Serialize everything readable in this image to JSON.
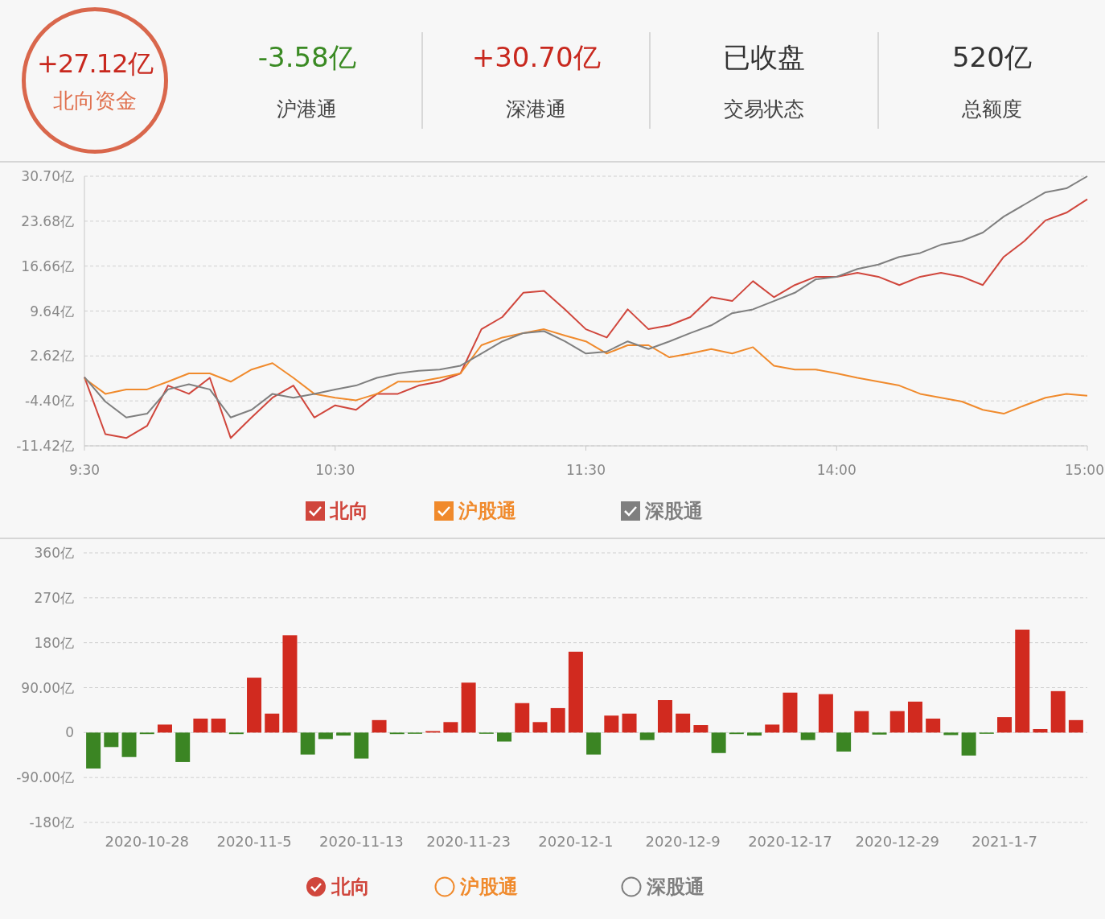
{
  "summary": {
    "value": "+27.12亿",
    "label": "北向资金",
    "kind": "up"
  },
  "stats": [
    {
      "value": "-3.58亿",
      "label": "沪港通",
      "kind": "down"
    },
    {
      "value": "+30.70亿",
      "label": "深港通",
      "kind": "up"
    },
    {
      "value": "已收盘",
      "label": "交易状态",
      "kind": "neutral"
    },
    {
      "value": "520亿",
      "label": "总额度",
      "kind": "neutral"
    }
  ],
  "line_chart": {
    "chart_data": {
      "type": "line",
      "categories": [
        "9:30",
        null,
        null,
        null,
        null,
        null,
        null,
        null,
        null,
        null,
        null,
        null,
        "10:30",
        null,
        null,
        null,
        null,
        null,
        null,
        null,
        null,
        null,
        null,
        null,
        "11:30",
        null,
        null,
        null,
        null,
        null,
        null,
        null,
        null,
        null,
        null,
        null,
        "14:00",
        null,
        null,
        null,
        null,
        null,
        null,
        null,
        null,
        null,
        null,
        null,
        "15:00"
      ],
      "ylim": [
        -11.42,
        30.7
      ],
      "grid": true,
      "yticks": [
        {
          "value": 30.7,
          "label": "30.70亿"
        },
        {
          "value": 23.68,
          "label": "23.68亿"
        },
        {
          "value": 16.66,
          "label": "16.66亿"
        },
        {
          "value": 9.64,
          "label": "9.64亿"
        },
        {
          "value": 2.62,
          "label": "2.62亿"
        },
        {
          "value": -4.4,
          "label": "-4.40亿"
        },
        {
          "value": -11.42,
          "label": "-11.42亿"
        }
      ],
      "series": [
        {
          "name": "北向",
          "color": "#d0463c",
          "values": [
            -0.7,
            -9.6,
            -10.2,
            -8.3,
            -2.0,
            -3.3,
            -0.8,
            -10.2,
            -7.0,
            -3.9,
            -2.0,
            -7.0,
            -5.1,
            -5.8,
            -3.3,
            -3.3,
            -2.0,
            -1.4,
            -0.1,
            6.8,
            8.7,
            12.5,
            12.8,
            9.9,
            6.8,
            5.5,
            9.9,
            6.8,
            7.4,
            8.7,
            11.8,
            11.2,
            14.3,
            11.8,
            13.7,
            15.0,
            15.0,
            15.6,
            15.0,
            13.7,
            15.0,
            15.6,
            15.0,
            13.7,
            18.1,
            20.6,
            23.8,
            25.0,
            27.1
          ]
        },
        {
          "name": "沪股通",
          "color": "#f08a2c",
          "values": [
            -0.9,
            -3.3,
            -2.6,
            -2.6,
            -1.4,
            -0.1,
            -0.1,
            -1.4,
            0.5,
            1.5,
            -0.8,
            -3.3,
            -3.9,
            -4.3,
            -3.3,
            -1.4,
            -1.4,
            -0.8,
            -0.1,
            4.3,
            5.5,
            6.2,
            6.8,
            5.8,
            4.9,
            3.0,
            4.3,
            4.3,
            2.4,
            3.0,
            3.7,
            3.0,
            4.0,
            1.1,
            0.5,
            0.5,
            -0.1,
            -0.8,
            -1.4,
            -2.0,
            -3.3,
            -3.9,
            -4.5,
            -5.8,
            -6.4,
            -5.1,
            -3.9,
            -3.3,
            -3.6
          ]
        },
        {
          "name": "深股通",
          "color": "#7f7f7f",
          "values": [
            -0.7,
            -4.5,
            -7.0,
            -6.4,
            -2.6,
            -1.8,
            -2.6,
            -7.0,
            -5.8,
            -3.3,
            -3.9,
            -3.3,
            -2.6,
            -2.0,
            -0.8,
            -0.1,
            0.3,
            0.5,
            1.1,
            3.0,
            4.9,
            6.2,
            6.5,
            4.9,
            3.0,
            3.3,
            4.9,
            3.7,
            4.9,
            6.2,
            7.4,
            9.3,
            9.9,
            11.2,
            12.5,
            14.6,
            15.0,
            16.2,
            16.9,
            18.1,
            18.7,
            20.0,
            20.6,
            21.9,
            24.4,
            26.3,
            28.2,
            28.8,
            30.7
          ]
        }
      ]
    },
    "legend": [
      {
        "checked": true
      },
      {
        "checked": true
      },
      {
        "checked": true
      }
    ]
  },
  "bar_chart": {
    "chart_data": {
      "type": "bar",
      "categories": [
        null,
        null,
        null,
        "2020-10-28",
        null,
        null,
        null,
        null,
        null,
        "2020-11-5",
        null,
        null,
        null,
        null,
        null,
        "2020-11-13",
        null,
        null,
        null,
        null,
        null,
        "2020-11-23",
        null,
        null,
        null,
        null,
        null,
        "2020-12-1",
        null,
        null,
        null,
        null,
        null,
        "2020-12-9",
        null,
        null,
        null,
        null,
        null,
        "2020-12-17",
        null,
        null,
        null,
        null,
        null,
        "2020-12-29",
        null,
        null,
        null,
        null,
        null,
        "2021-1-7",
        null,
        null,
        null,
        null
      ],
      "ylim": [
        -180,
        360
      ],
      "yticks": [
        {
          "value": 360,
          "label": "360亿"
        },
        {
          "value": 270,
          "label": "270亿"
        },
        {
          "value": 180,
          "label": "180亿"
        },
        {
          "value": 90,
          "label": "90.00亿"
        },
        {
          "value": 0,
          "label": "0"
        },
        {
          "value": -90,
          "label": "-90.00亿"
        },
        {
          "value": -180,
          "label": "-180亿"
        }
      ],
      "grid": true,
      "stacked": true,
      "series": [
        {
          "name": "北向",
          "color": "#d12a1f",
          "values": [
            null,
            null,
            null,
            null,
            16,
            null,
            28,
            28,
            null,
            110,
            38,
            195,
            null,
            null,
            null,
            null,
            25,
            null,
            null,
            3,
            21,
            100,
            null,
            null,
            59,
            21,
            49,
            162,
            null,
            34,
            38,
            null,
            65,
            38,
            15,
            null,
            null,
            null,
            16,
            80,
            null,
            77,
            null,
            43,
            null,
            43,
            62,
            28,
            null,
            null,
            null,
            31,
            206,
            7,
            83,
            25
          ]
        },
        {
          "color": "#3b8523",
          "values": [
            -72,
            -29,
            -49,
            -3,
            null,
            -59,
            null,
            null,
            -3,
            null,
            null,
            null,
            -44,
            -13,
            -6,
            -52,
            null,
            -3,
            -2,
            null,
            null,
            null,
            -2,
            -18,
            null,
            null,
            null,
            null,
            -44,
            null,
            null,
            -15,
            null,
            null,
            null,
            -41,
            -3,
            -6,
            null,
            null,
            -15,
            null,
            -38,
            null,
            -4,
            null,
            null,
            null,
            -5,
            -46,
            -2,
            null,
            null,
            null,
            null,
            null
          ]
        }
      ]
    },
    "legend": [
      {
        "selected": true,
        "color": "#d0463c"
      },
      {
        "label": "沪股通",
        "selected": false,
        "color": "#f08a2c"
      },
      {
        "label": "深股通",
        "selected": false,
        "color": "#7f7f7f"
      }
    ]
  }
}
